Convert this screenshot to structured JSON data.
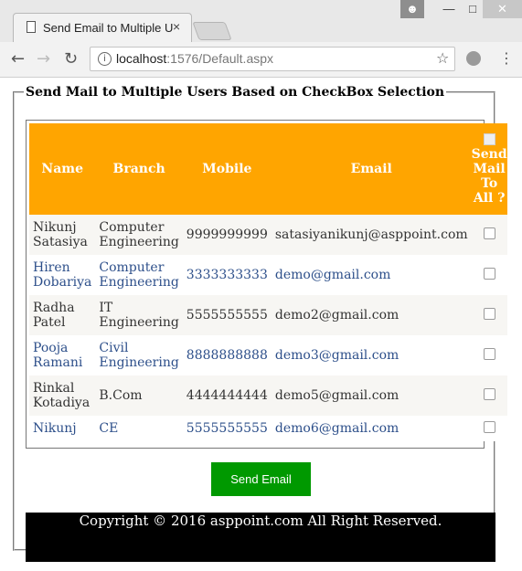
{
  "browser": {
    "tab_title": "Send Email to Multiple U",
    "tab_close": "×",
    "url_host": "localhost",
    "url_path": ":1576/Default.aspx"
  },
  "page": {
    "legend": "Send Mail to Multiple Users Based on CheckBox Selection",
    "columns": [
      "Name",
      "Branch",
      "Mobile",
      "Email",
      "Send Mail To All ?"
    ],
    "rows": [
      {
        "name": "Nikunj Satasiya",
        "branch": "Computer Engineering",
        "mobile": "9999999999",
        "email": "satasiyanikunj@asppoint.com"
      },
      {
        "name": "Hiren Dobariya",
        "branch": "Computer Engineering",
        "mobile": "3333333333",
        "email": "demo@gmail.com"
      },
      {
        "name": "Radha Patel",
        "branch": "IT Engineering",
        "mobile": "5555555555",
        "email": "demo2@gmail.com"
      },
      {
        "name": "Pooja Ramani",
        "branch": "Civil Engineering",
        "mobile": "8888888888",
        "email": "demo3@gmail.com"
      },
      {
        "name": "Rinkal Kotadiya",
        "branch": "B.Com",
        "mobile": "4444444444",
        "email": "demo5@gmail.com"
      },
      {
        "name": "Nikunj",
        "branch": "CE",
        "mobile": "5555555555",
        "email": "demo6@gmail.com"
      }
    ],
    "send_button": "Send Email",
    "footer": "Copyright © 2016 asppoint.com All Right Reserved."
  },
  "colors": {
    "header": "#ffa500",
    "button": "#009900",
    "footer": "#000000"
  }
}
